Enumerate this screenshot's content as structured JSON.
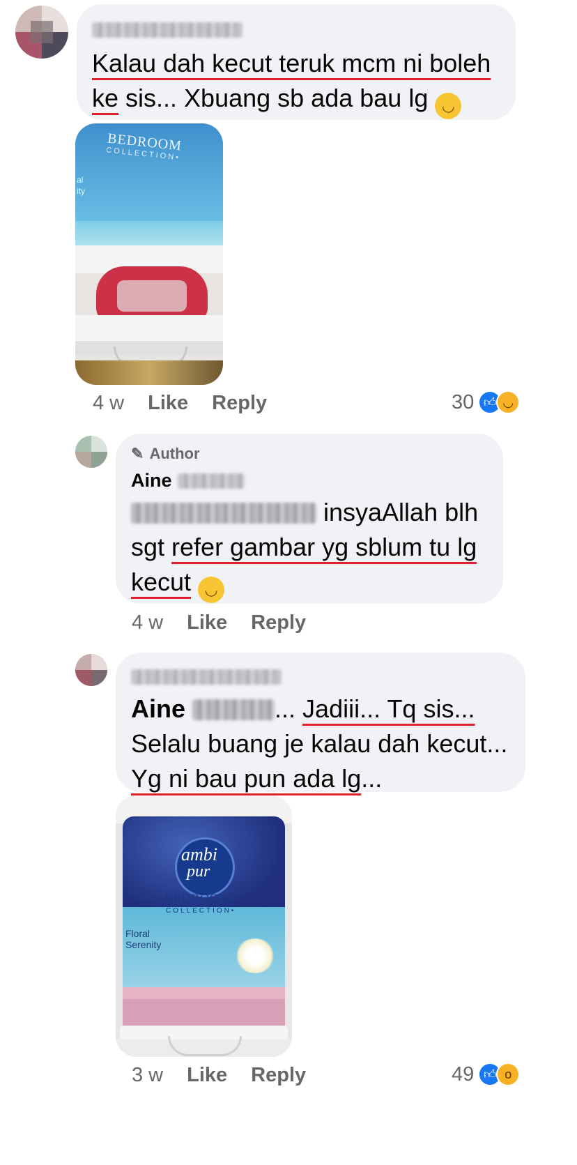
{
  "comment1": {
    "text_line1": "Kalau dah kecut teruk mcm ni boleh",
    "text_line2_u": "ke",
    "text_line2_rest": " sis... Xbuang sb ada bau lg",
    "photo_label_line1": "BEDROOM",
    "photo_label_line2": "COLLECTION•",
    "photo_label_side1": "al",
    "photo_label_side2": "ity",
    "time": "4 w",
    "like_label": "Like",
    "reply_label": "Reply",
    "reaction_count": "30",
    "reaction_icons": [
      "like-icon",
      "haha-icon"
    ]
  },
  "comment2": {
    "author_badge": "Author",
    "author_first_name": "Aine",
    "text_after_mention": " insyaAllah blh",
    "line2_prefix": "sgt ",
    "line2_u": "refer gambar yg sblum tu lg",
    "line3_u": "kecut",
    "time": "4 w",
    "like_label": "Like",
    "reply_label": "Reply"
  },
  "comment3": {
    "mention_first": "Aine",
    "line1_rest_prefix": "... ",
    "line1_u": "Jadiii... Tq sis...",
    "line2": "Selalu buang je kalau dah kecut...",
    "line3_u": "Yg ni bau pun ada lg",
    "line3_rest": "...",
    "photo_brand1": "ambi",
    "photo_brand2": "pur",
    "photo_label_line1": "BEDROOM",
    "photo_label_line2": "COLLECTION•",
    "photo_side1": "Floral",
    "photo_side2": "Serenity",
    "time": "3 w",
    "like_label": "Like",
    "reply_label": "Reply",
    "reaction_count": "49",
    "reaction_icons": [
      "like-icon",
      "wow-icon"
    ]
  },
  "colors": {
    "bubble": "#f0f2f5",
    "meta": "#65676b",
    "underline": "#e0202c",
    "like_blue": "#1877f2"
  }
}
